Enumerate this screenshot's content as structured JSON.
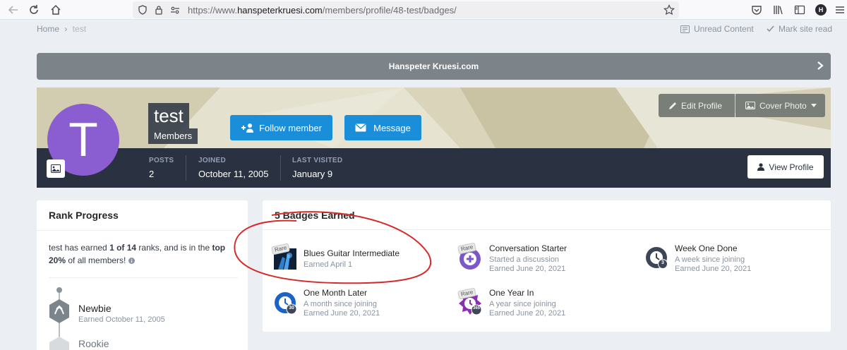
{
  "browser": {
    "url_prefix": "https://www.",
    "url_host": "hanspeterkruesi.com",
    "url_path": "/members/profile/48-test/badges/",
    "profile_initial": "H"
  },
  "breadcrumb": {
    "home": "Home",
    "separator": "›",
    "current": "test"
  },
  "top_links": {
    "unread": "Unread Content",
    "mark_read": "Mark site read"
  },
  "site": {
    "title": "Hanspeter Kruesi.com"
  },
  "profile": {
    "avatar_letter": "T",
    "name": "test",
    "group": "Members",
    "follow_label": "Follow member",
    "message_label": "Message",
    "edit_profile_label": "Edit Profile",
    "cover_photo_label": "Cover Photo",
    "view_profile_label": "View Profile",
    "stats": [
      {
        "label": "POSTS",
        "value": "2"
      },
      {
        "label": "JOINED",
        "value": "October 11, 2005"
      },
      {
        "label": "LAST VISITED",
        "value": "January 9"
      }
    ]
  },
  "rank": {
    "title": "Rank Progress",
    "text_pre": "test has earned ",
    "text_bold1": "1 of 14",
    "text_mid": " ranks, and is in the ",
    "text_bold2": "top 20%",
    "text_post": " of all members!",
    "items": [
      {
        "name": "Newbie",
        "earned": "Earned October 11, 2005"
      },
      {
        "name": "Rookie"
      }
    ]
  },
  "badges": {
    "title": "5 Badges Earned",
    "rare_label": "Rare",
    "items": [
      {
        "title": "Blues Guitar Intermediate",
        "desc": "",
        "earned": "Earned April 1",
        "rare": true
      },
      {
        "title": "Conversation Starter",
        "desc": "Started a discussion",
        "earned": "Earned June 20, 2021",
        "rare": true
      },
      {
        "title": "Week One Done",
        "desc": "A week since joining",
        "earned": "Earned June 20, 2021",
        "rare": false,
        "icon_badge": "3"
      },
      {
        "title": "One Month Later",
        "desc": "A month since joining",
        "earned": "Earned June 20, 2021",
        "rare": false,
        "icon_badge": "30"
      },
      {
        "title": "One Year In",
        "desc": "A year since joining",
        "earned": "Earned June 20, 2021",
        "rare": true,
        "icon_badge": "365"
      }
    ]
  },
  "colors": {
    "accent_blue": "#1b8ed9",
    "avatar_purple": "#8a5ed0",
    "cover_bar": "#2a3241",
    "header_grey": "#7d8489",
    "annotation_red": "#d62b2b"
  }
}
